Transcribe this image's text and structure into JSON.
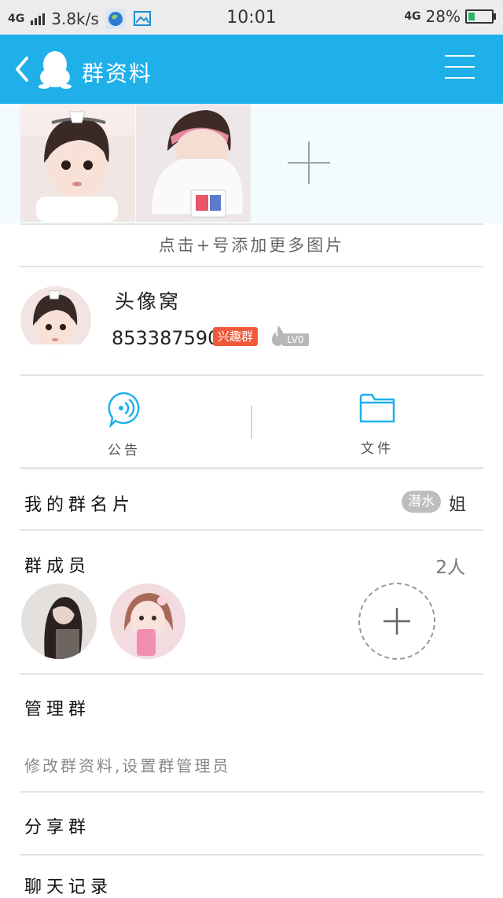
{
  "status_bar": {
    "network": "4G",
    "speed": "3.8k/s",
    "time": "10:01",
    "network_right": "4G",
    "battery": "28%",
    "battery_level": 0.28
  },
  "header": {
    "title": "群资料"
  },
  "photos": {
    "hint": "点击+号添加更多图片"
  },
  "group": {
    "name": "头像窝",
    "id": "853387590",
    "tag": "兴趣群",
    "level": "LV0"
  },
  "features": {
    "announcement": "公告",
    "files": "文件"
  },
  "my_card": {
    "label": "我的群名片",
    "badge": "潜水",
    "nickname": "姐"
  },
  "members": {
    "label": "群成员",
    "count": "2人"
  },
  "manage": {
    "label": "管理群",
    "desc": "修改群资料,设置群管理员"
  },
  "share": {
    "label": "分享群"
  },
  "chat_history": {
    "label": "聊天记录"
  },
  "colors": {
    "accent": "#1fb0ea",
    "tag_red": "#f05a3c"
  }
}
